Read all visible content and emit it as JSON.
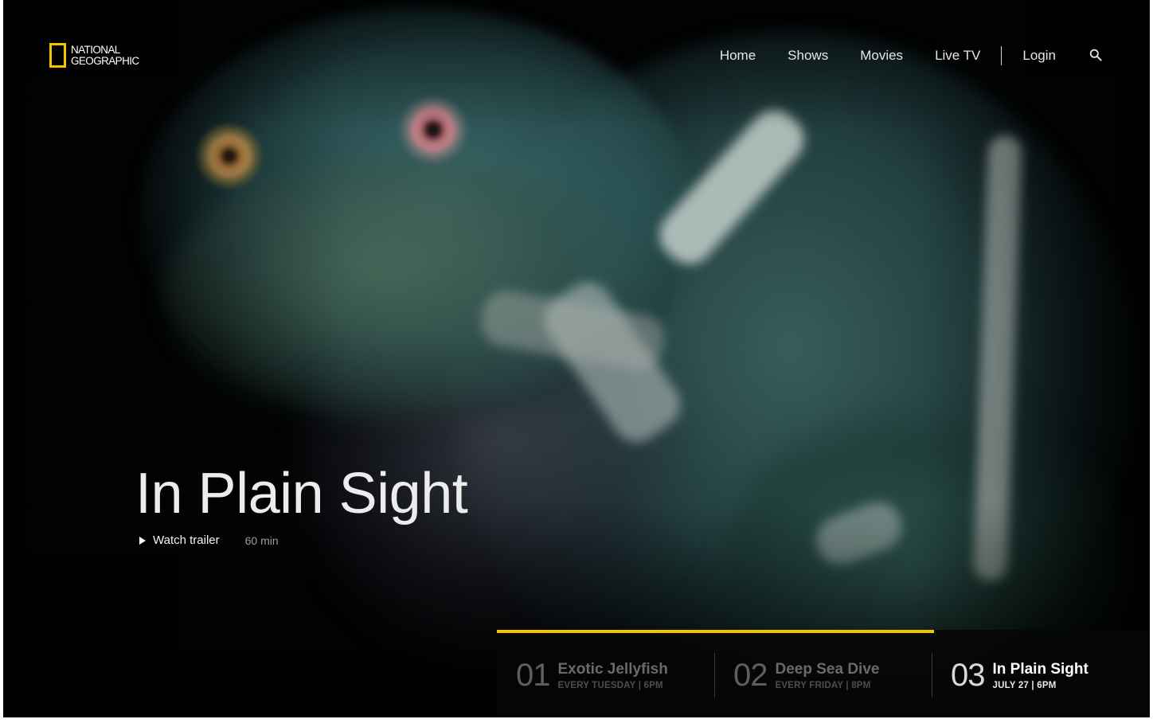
{
  "brand": {
    "line1": "NATIONAL",
    "line2": "GEOGRAPHIC",
    "accent_color": "#f2c500"
  },
  "nav": {
    "items": [
      "Home",
      "Shows",
      "Movies",
      "Live TV"
    ],
    "login": "Login",
    "search_icon": "search-icon"
  },
  "hero": {
    "title": "In Plain Sight",
    "watch_trailer": "Watch trailer",
    "duration": "60 min"
  },
  "schedule": {
    "progress": 0.67,
    "items": [
      {
        "num": "01",
        "title": "Exotic Jellyfish",
        "sub": "EVERY TUESDAY | 6PM",
        "active": false
      },
      {
        "num": "02",
        "title": "Deep Sea Dive",
        "sub": "EVERY FRIDAY | 8PM",
        "active": false
      },
      {
        "num": "03",
        "title": "In Plain Sight",
        "sub": "JULY 27 | 6PM",
        "active": true
      }
    ]
  }
}
